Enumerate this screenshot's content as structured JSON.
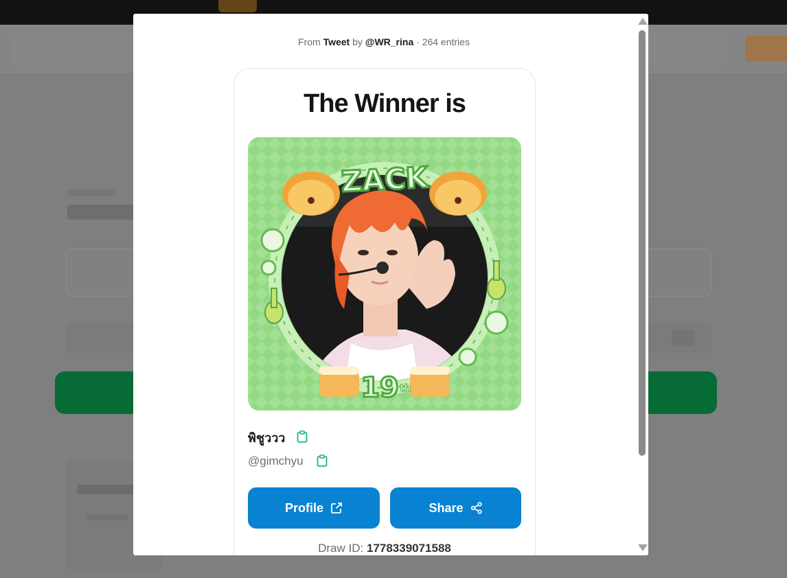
{
  "modal": {
    "source_from": "From",
    "source_type": "Tweet",
    "source_by": "by",
    "source_author": "@WR_rina",
    "source_sep": "·",
    "entries": "264 entries",
    "title": "The Winner is",
    "winner_name": "พิชูววว",
    "winner_handle": "@gimchyu",
    "profile_button": "Profile",
    "share_button": "Share",
    "draw_id_label": "Draw ID:",
    "draw_id_value": "1778339071588",
    "image": {
      "top_text": "ZACK",
      "badge_text": "19",
      "badge_suffix": "th"
    }
  },
  "colors": {
    "button": "#0a82d2",
    "copy_icon": "#18b877",
    "image_bg": "#8fd67f",
    "hair": "#f06a33"
  },
  "icons": {
    "copy": "clipboard-icon",
    "profile": "external-link-icon",
    "share": "share-icon"
  }
}
